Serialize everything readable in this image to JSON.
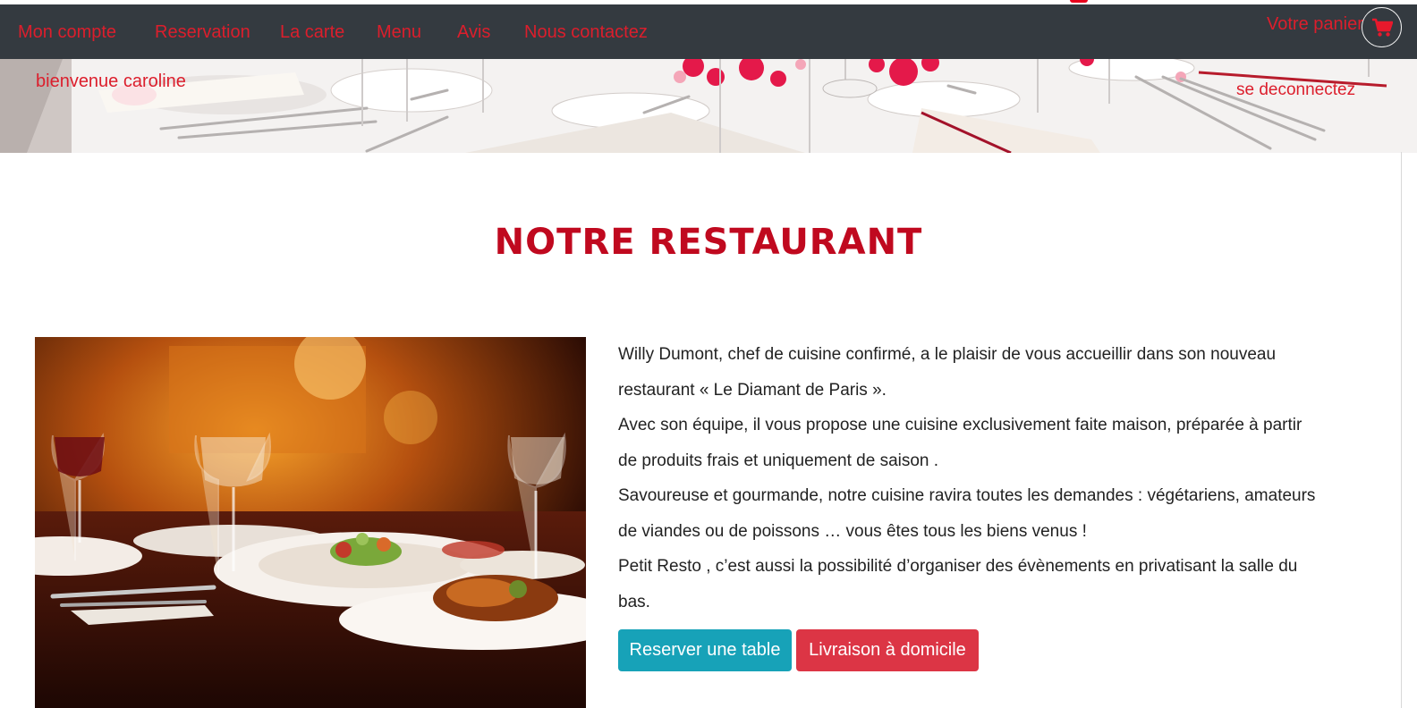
{
  "nav": {
    "items": [
      {
        "label": "Mon compte"
      },
      {
        "label": "Reservation"
      },
      {
        "label": "La carte"
      },
      {
        "label": "Menu"
      },
      {
        "label": "Avis"
      },
      {
        "label": "Nous contactez"
      }
    ],
    "cart_label": "Votre panier",
    "cart_icon": "shopping-cart-icon"
  },
  "banner": {
    "welcome": "bienvenue caroline",
    "logout": "se deconnectez"
  },
  "main": {
    "title": "NOTRE RESTAURANT",
    "paragraphs": [
      "Willy Dumont, chef de cuisine confirmé, a le plaisir de vous accueillir dans son nouveau restaurant « Le Diamant de Paris ».",
      "Avec son équipe, il vous propose une cuisine exclusivement faite maison, préparée à partir de produits frais et uniquement de saison .",
      "Savoureuse et gourmande, notre cuisine ravira toutes les demandes : végétariens, amateurs de viandes ou de poissons … vous êtes tous les biens venus !",
      "Petit Resto , c’est aussi la possibilité d’organiser des évènements en privatisant la salle du bas."
    ],
    "buttons": {
      "reserve": "Reserver une table",
      "delivery": "Livraison à domicile"
    }
  },
  "colors": {
    "navbar": "#343a40",
    "accent_red": "#dc1e2c",
    "title_red": "#c0091f",
    "button_teal": "#17a2b8",
    "button_red": "#dc3545"
  }
}
